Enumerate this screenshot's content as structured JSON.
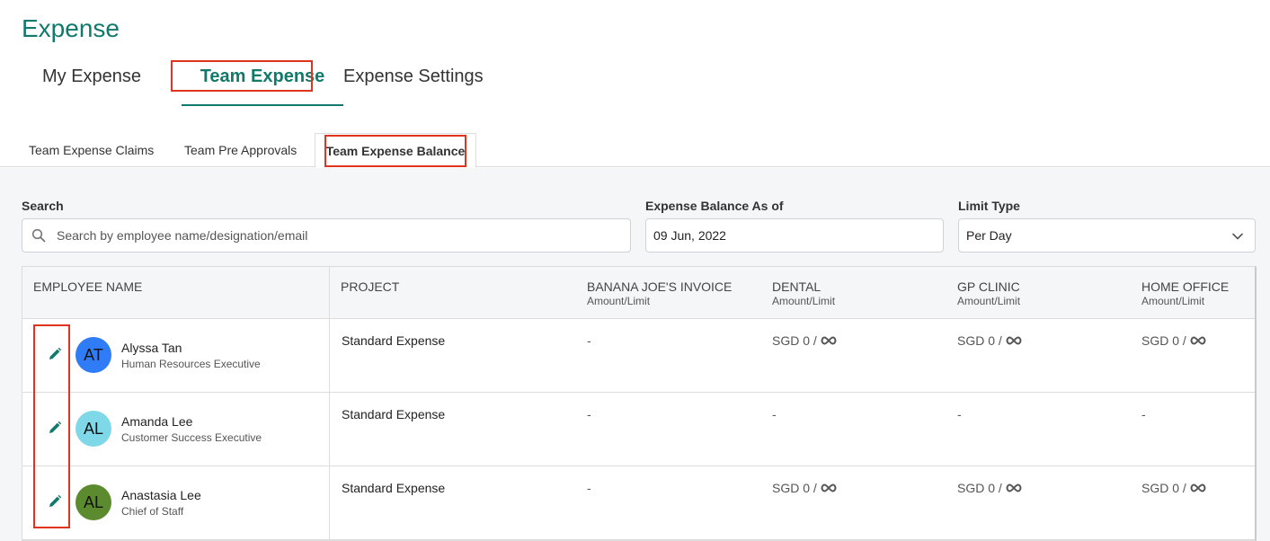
{
  "page": {
    "title": "Expense"
  },
  "main_tabs": [
    {
      "label": "My Expense",
      "active": false
    },
    {
      "label": "Team Expense",
      "active": true
    },
    {
      "label": "Expense Settings",
      "active": false
    }
  ],
  "sub_tabs": [
    {
      "label": "Team Expense Claims",
      "active": false
    },
    {
      "label": "Team Pre Approvals",
      "active": false
    },
    {
      "label": "Team Expense Balance",
      "active": true
    }
  ],
  "filters": {
    "search": {
      "label": "Search",
      "placeholder": "Search by employee name/designation/email",
      "value": ""
    },
    "balance_as_of": {
      "label": "Expense Balance As of",
      "value": "09 Jun, 2022"
    },
    "limit_type": {
      "label": "Limit Type",
      "value": "Per Day"
    }
  },
  "table": {
    "columns": [
      {
        "title": "EMPLOYEE NAME",
        "sub": ""
      },
      {
        "title": "PROJECT",
        "sub": ""
      },
      {
        "title": "BANANA JOE'S INVOICE",
        "sub": "Amount/Limit"
      },
      {
        "title": "DENTAL",
        "sub": "Amount/Limit"
      },
      {
        "title": "GP CLINIC",
        "sub": "Amount/Limit"
      },
      {
        "title": "HOME OFFICE",
        "sub": "Amount/Limit"
      }
    ],
    "rows": [
      {
        "initials": "AT",
        "avatar_color": "#2f7cf6",
        "name": "Alyssa Tan",
        "designation": "Human Resources Executive",
        "project": "Standard Expense",
        "banana": "-",
        "dental": "SGD 0 /",
        "gp": "SGD 0 /",
        "home": "SGD 0 /"
      },
      {
        "initials": "AL",
        "avatar_color": "#7fd8e8",
        "name": "Amanda Lee",
        "designation": "Customer Success Executive",
        "project": "Standard Expense",
        "banana": "-",
        "dental": "-",
        "gp": "-",
        "home": "-"
      },
      {
        "initials": "AL",
        "avatar_color": "#5c8a2e",
        "name": "Anastasia Lee",
        "designation": "Chief of Staff",
        "project": "Standard Expense",
        "banana": "-",
        "dental": "SGD 0 /",
        "gp": "SGD 0 /",
        "home": "SGD 0 /"
      }
    ]
  },
  "colors": {
    "brand": "#127a6c",
    "highlight": "#e0341f"
  },
  "icons": {
    "search": "search-icon",
    "edit": "pencil-icon",
    "limit": "infinity-icon",
    "dropdown": "chevron-down-icon"
  }
}
